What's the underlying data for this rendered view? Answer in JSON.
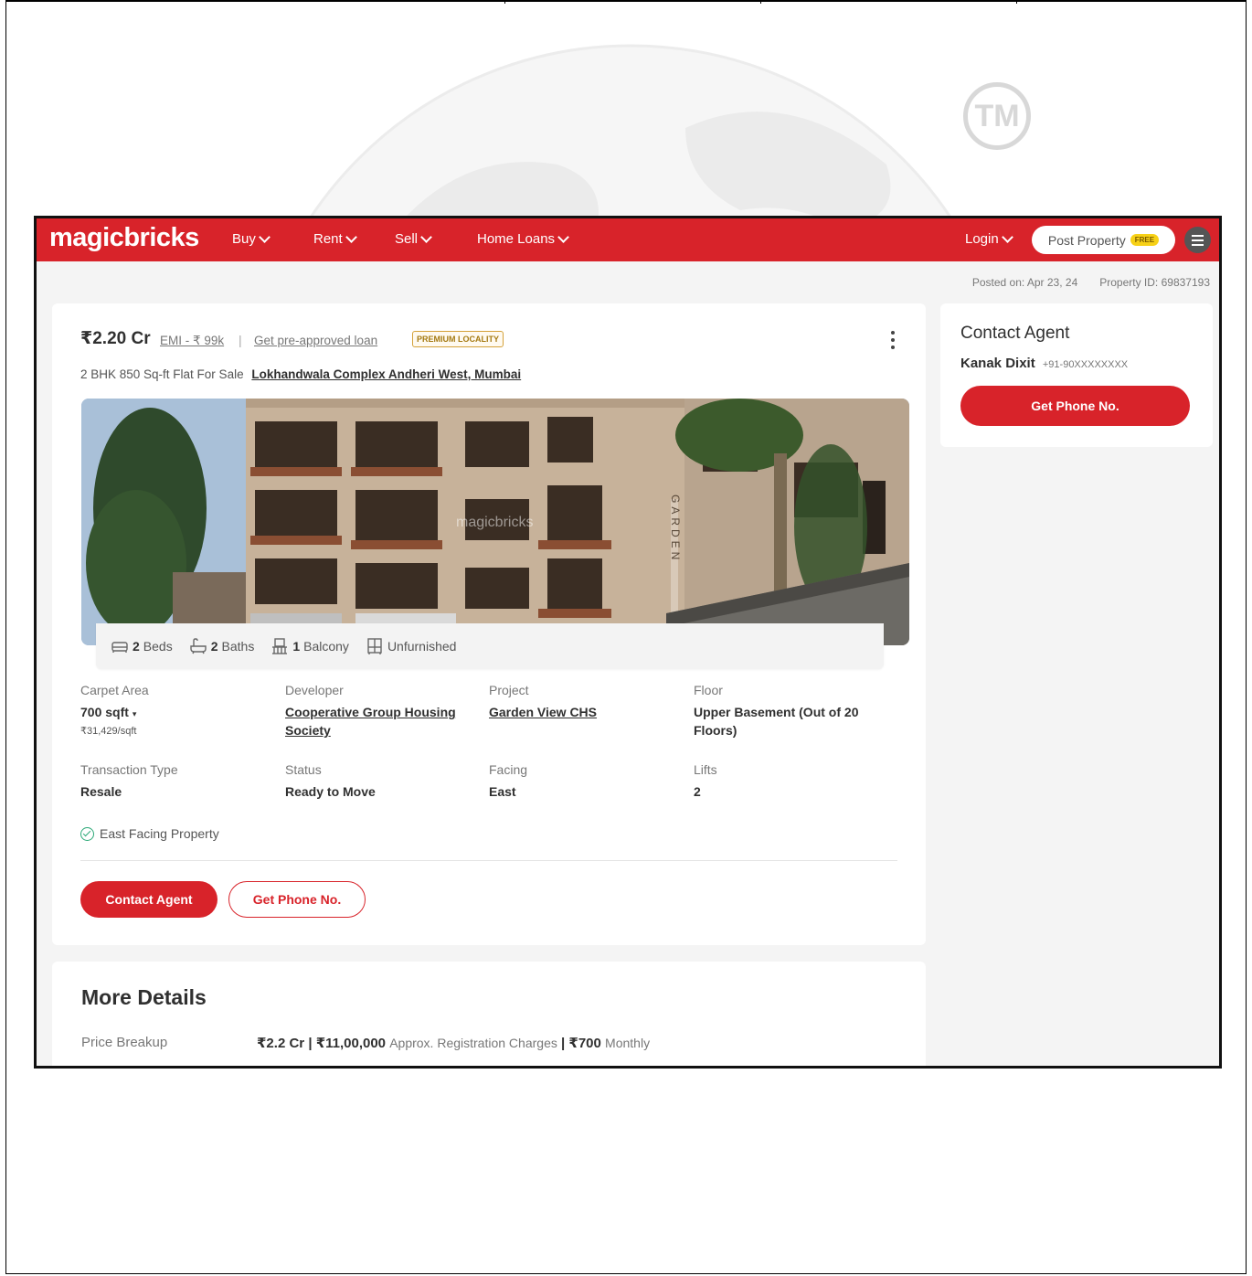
{
  "watermark": {
    "tm": "TM"
  },
  "header": {
    "logo": "magicbricks",
    "nav": [
      {
        "label": "Buy"
      },
      {
        "label": "Rent"
      },
      {
        "label": "Sell"
      },
      {
        "label": "Home Loans"
      }
    ],
    "login": "Login",
    "post_property": "Post Property",
    "free_badge": "FREE"
  },
  "meta": {
    "posted": "Posted on: Apr 23, 24",
    "property_id": "Property ID: 69837193"
  },
  "listing": {
    "price": "₹2.20 Cr",
    "emi": "EMI - ₹ 99k",
    "separator": "|",
    "loan_link": "Get pre-approved loan",
    "premium_badge": "PREMIUM LOCALITY",
    "subtitle": "2 BHK 850 Sq-ft Flat For Sale",
    "location": "Lokhandwala Complex Andheri West, Mumbai",
    "photo_watermark": "magicbricks",
    "photo_sign": "GARDEN",
    "amenities": {
      "beds_count": "2",
      "beds_label": "Beds",
      "baths_count": "2",
      "baths_label": "Baths",
      "balcony_count": "1",
      "balcony_label": "Balcony",
      "furnishing": "Unfurnished"
    },
    "attributes": {
      "carpet_area": {
        "label": "Carpet Area",
        "value": "700 sqft",
        "sub": "₹31,429/sqft"
      },
      "developer": {
        "label": "Developer",
        "value": "Cooperative Group Housing Society"
      },
      "project": {
        "label": "Project",
        "value": "Garden View CHS"
      },
      "floor": {
        "label": "Floor",
        "value": "Upper Basement (Out of 20 Floors)"
      },
      "transaction": {
        "label": "Transaction Type",
        "value": "Resale"
      },
      "status": {
        "label": "Status",
        "value": "Ready to Move"
      },
      "facing": {
        "label": "Facing",
        "value": "East"
      },
      "lifts": {
        "label": "Lifts",
        "value": "2"
      }
    },
    "facing_note": "East Facing Property",
    "contact_agent_btn": "Contact Agent",
    "get_phone_btn": "Get Phone No."
  },
  "sidebar": {
    "title": "Contact Agent",
    "agent_name": "Kanak Dixit",
    "agent_phone": "+91-90XXXXXXXX",
    "get_phone_btn": "Get Phone No."
  },
  "more_details": {
    "title": "More Details",
    "price_breakup_label": "Price Breakup",
    "price": "₹2.2 Cr",
    "pipe": "|",
    "registration": "₹11,00,000",
    "registration_label": "Approx. Registration Charges",
    "maintenance": "₹700",
    "maintenance_label": "Monthly"
  },
  "colors": {
    "brand": "#d8232a",
    "text": "#303030",
    "muted": "#777777",
    "success": "#2aa876"
  }
}
